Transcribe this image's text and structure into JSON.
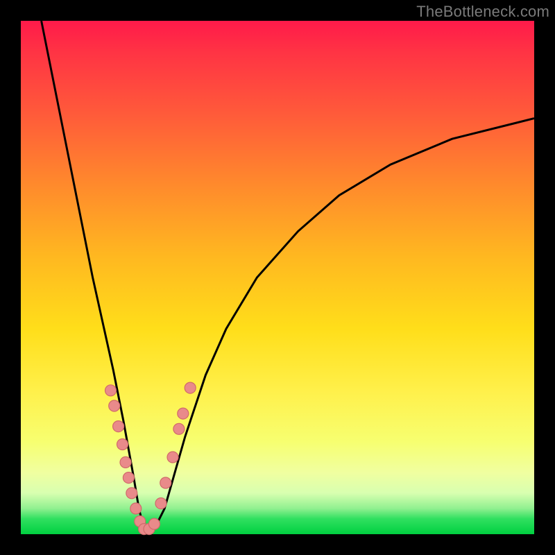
{
  "watermark": "TheBottleneck.com",
  "colors": {
    "frame": "#000000",
    "gradient_top": "#ff1a4a",
    "gradient_bottom": "#00d040",
    "curve": "#000000",
    "dot_fill": "#e98a8a",
    "dot_stroke": "#d06a6a"
  },
  "chart_data": {
    "type": "line",
    "title": "",
    "xlabel": "",
    "ylabel": "",
    "xlim": [
      0,
      100
    ],
    "ylim": [
      0,
      100
    ],
    "description": "V-shaped bottleneck curve. Vertical axis = bottleneck percentage (0 at bottom, 100 at top). Horizontal axis = relative component balance (arbitrary 0–100). Minimum (0% bottleneck) sits near x≈24. Pink dots mark sampled hardware combinations clustered near the minimum.",
    "series": [
      {
        "name": "bottleneck-curve",
        "x": [
          4,
          6,
          8,
          10,
          12,
          14,
          16,
          18,
          20,
          22,
          23,
          24,
          25,
          26,
          28,
          30,
          32,
          36,
          40,
          46,
          54,
          62,
          72,
          84,
          96,
          100
        ],
        "y": [
          100,
          90,
          80,
          70,
          60,
          50,
          41,
          32,
          22,
          11,
          5,
          1,
          0.5,
          1,
          5,
          12,
          19,
          31,
          40,
          50,
          59,
          66,
          72,
          77,
          80,
          81
        ]
      }
    ],
    "points": {
      "name": "sampled-configs",
      "x": [
        17.5,
        18.2,
        19.0,
        19.8,
        20.4,
        21.0,
        21.6,
        22.4,
        23.2,
        24.0,
        25.0,
        26.0,
        27.3,
        28.2,
        29.6,
        30.8,
        31.6,
        33.0
      ],
      "y": [
        28.0,
        25.0,
        21.0,
        17.5,
        14.0,
        11.0,
        8.0,
        5.0,
        2.5,
        1.0,
        1.0,
        2.0,
        6.0,
        10.0,
        15.0,
        20.5,
        23.5,
        28.5
      ]
    }
  }
}
